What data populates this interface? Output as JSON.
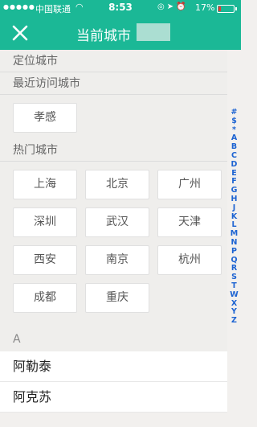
{
  "status": {
    "carrier": "中国联通",
    "time": "8:53",
    "battery": "17%",
    "battery_level": 0.17
  },
  "header": {
    "title": "当前城市"
  },
  "sections": {
    "locate": "定位城市",
    "recent": "最近访问城市",
    "hot": "热门城市"
  },
  "recent_cities": [
    "孝感"
  ],
  "hot_cities": [
    "上海",
    "北京",
    "广州",
    "深圳",
    "武汉",
    "天津",
    "西安",
    "南京",
    "杭州",
    "成都",
    "重庆"
  ],
  "list": {
    "letter": "A",
    "cities": [
      "阿勒泰",
      "阿克苏"
    ]
  },
  "index": [
    "#",
    "$",
    "*",
    "A",
    "B",
    "C",
    "D",
    "E",
    "F",
    "G",
    "H",
    "J",
    "K",
    "L",
    "M",
    "N",
    "P",
    "Q",
    "R",
    "S",
    "T",
    "W",
    "X",
    "Y",
    "Z"
  ],
  "colors": {
    "accent": "#1bb896",
    "index": "#1e64d2"
  }
}
